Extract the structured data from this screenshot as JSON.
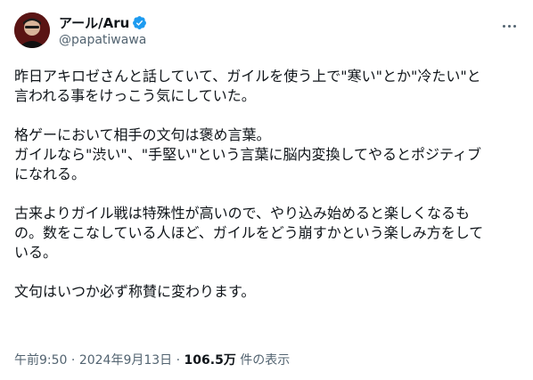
{
  "author": {
    "display_name": "アール/Aru",
    "handle": "@papatiwawa",
    "verified": true
  },
  "more_menu_icon": "ellipsis-icon",
  "paragraphs": [
    {
      "lines": [
        "昨日アキロゼさんと話していて、ガイルを使う上で\"寒い\"とか\"冷たい\"と",
        "言われる事をけっこう気にしていた。"
      ]
    },
    {
      "lines": [
        "格ゲーにおいて相手の文句は褒め言葉。",
        "ガイルなら\"渋い\"、\"手堅い\"という言葉に脳内変換してやるとポジティブ",
        "になれる。"
      ]
    },
    {
      "lines": [
        "古来よりガイル戦は特殊性が高いので、やり込み始めると楽しくなるも",
        "の。数をこなしている人ほど、ガイルをどう崩すかという楽しみ方をして",
        "いる。"
      ]
    },
    {
      "lines": [
        "文句はいつか必ず称賛に変わります。"
      ]
    }
  ],
  "meta": {
    "time": "午前9:50",
    "separator": " · ",
    "date": "2024年9月13日",
    "separator2": " · ",
    "views_count": "106.5万",
    "views_label": " 件の表示"
  },
  "colors": {
    "text": "#0f1419",
    "secondary": "#536471",
    "verified": "#1d9bf0"
  }
}
